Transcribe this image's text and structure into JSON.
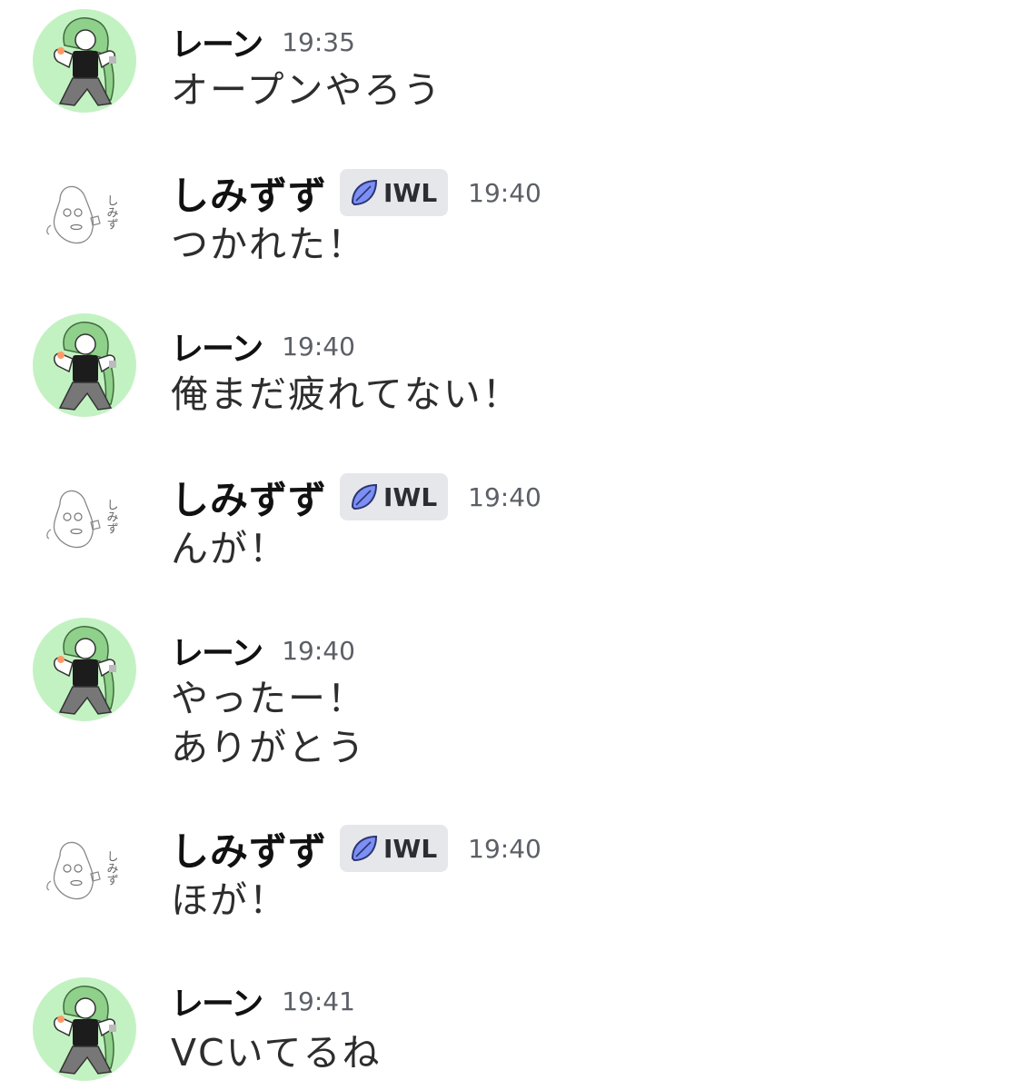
{
  "colors": {
    "avatar_green": "#c3f2c2",
    "badge_bg": "#e6e7ea",
    "badge_icon": "#7b8ff5",
    "timestamp": "#5c5f66"
  },
  "badge": {
    "icon": "leaf-icon",
    "label": "IWL"
  },
  "messages": [
    {
      "author": "レーン",
      "time": "19:35",
      "lines": [
        "オープンやろう"
      ]
    },
    {
      "author": "しみずず",
      "time": "19:40",
      "lines": [
        "つかれた！"
      ]
    },
    {
      "author": "レーン",
      "time": "19:40",
      "lines": [
        "俺まだ疲れてない！"
      ]
    },
    {
      "author": "しみずず",
      "time": "19:40",
      "lines": [
        "んが！"
      ]
    },
    {
      "author": "レーン",
      "time": "19:40",
      "lines": [
        "やったー！",
        "ありがとう"
      ]
    },
    {
      "author": "しみずず",
      "time": "19:40",
      "lines": [
        "ほが！"
      ]
    },
    {
      "author": "レーン",
      "time": "19:41",
      "lines": [
        "VCいてるね"
      ]
    }
  ],
  "avatars": {
    "ren": {
      "icon": "ren-avatar-illustration"
    },
    "shimizuzu": {
      "icon": "shimizuzu-avatar-sketch",
      "scribble": "しみず"
    }
  }
}
